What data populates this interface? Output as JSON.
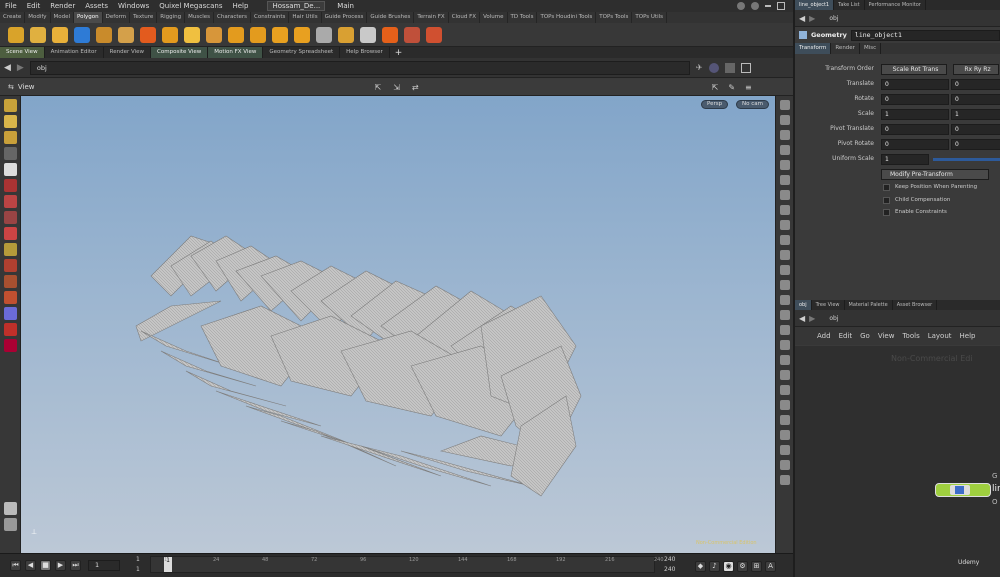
{
  "menubar": {
    "items": [
      "File",
      "Edit",
      "Render",
      "Assets",
      "Windows",
      "Quixel Megascans",
      "Help"
    ],
    "desktop": "Hossam_De...",
    "main": "Main"
  },
  "shelf_tabs": [
    "Create",
    "Modify",
    "Model",
    "Polygon",
    "Deform",
    "Texture",
    "Rigging",
    "Muscles",
    "Characters",
    "Constraints",
    "Hair Utils",
    "Guide Process",
    "Guide Brushes",
    "Terrain FX",
    "Cloud FX",
    "Volume",
    "TD Tools",
    "TOPs Houdini Tools",
    "TOPs Tools",
    "TOPs Utils"
  ],
  "shelf_tools": [
    {
      "icon": "poly-extrude-icon",
      "color": "#d9a32a"
    },
    {
      "icon": "poly-box-icon",
      "color": "#e0b040"
    },
    {
      "icon": "poly-cube-icon",
      "color": "#e8b03a"
    },
    {
      "icon": "poly-blue-icon",
      "color": "#2e7bd6"
    },
    {
      "icon": "poly-bevel-icon",
      "color": "#c98b2b"
    },
    {
      "icon": "poly-disc-icon",
      "color": "#d4a04a"
    },
    {
      "icon": "poly-sphere-icon",
      "color": "#e35b1e"
    },
    {
      "icon": "poly-diamond-icon",
      "color": "#e39b1e"
    },
    {
      "icon": "star-icon",
      "color": "#f0c040"
    },
    {
      "icon": "poly-planet-icon",
      "color": "#d7963a"
    },
    {
      "icon": "poly-diamond2-icon",
      "color": "#e39b1e"
    },
    {
      "icon": "poly-diamond3-icon",
      "color": "#e39b1e"
    },
    {
      "icon": "poly-diamond4-icon",
      "color": "#e8a020"
    },
    {
      "icon": "poly-diamond5-icon",
      "color": "#e8a020"
    },
    {
      "icon": "brush-icon",
      "color": "#aaaaaa"
    },
    {
      "icon": "planet-ring-icon",
      "color": "#d9a032"
    },
    {
      "icon": "cloud-tool-icon",
      "color": "#c9c9c9"
    },
    {
      "icon": "fire-icon",
      "color": "#e5601a"
    },
    {
      "icon": "stamp-icon",
      "color": "#c0503a"
    },
    {
      "icon": "book-icon",
      "color": "#d05030"
    }
  ],
  "pane_tabs": [
    "Scene View",
    "Animation Editor",
    "Render View",
    "Composite View",
    "Motion FX View",
    "Geometry Spreadsheet",
    "Help Browser"
  ],
  "path": "obj",
  "viewer": {
    "label": "View",
    "persp": "Persp",
    "cam": "No cam",
    "watermark": "Non-Commercial Edition"
  },
  "timeline": {
    "frame": "1",
    "start": "1",
    "start2": "1",
    "end": "240",
    "end2": "240",
    "ticks": [
      "1",
      "24",
      "48",
      "72",
      "96",
      "120",
      "144",
      "168",
      "192",
      "216",
      "240"
    ]
  },
  "right_panel": {
    "tabs": [
      "line_object1",
      "Take List",
      "Performance Monitor"
    ],
    "path": "obj",
    "node_type": "Geometry",
    "node_name": "line_object1",
    "param_tabs": [
      "Transform",
      "Render",
      "Misc"
    ],
    "transform_order_label": "Transform Order",
    "transform_order": "Scale Rot Trans",
    "rot_order": "Rx Ry Rz",
    "params": [
      {
        "label": "Translate",
        "v1": "0",
        "v2": "0"
      },
      {
        "label": "Rotate",
        "v1": "0",
        "v2": "0"
      },
      {
        "label": "Scale",
        "v1": "1",
        "v2": "1"
      },
      {
        "label": "Pivot Translate",
        "v1": "0",
        "v2": "0"
      },
      {
        "label": "Pivot Rotate",
        "v1": "0",
        "v2": "0"
      }
    ],
    "uniform_scale_label": "Uniform Scale",
    "uniform_scale": "1",
    "modify_pre": "Modify Pre-Transform",
    "checkboxes": [
      "Keep Position When Parenting",
      "Child Compensation",
      "Enable Constraints"
    ],
    "network_tabs": [
      "obj",
      "Tree View",
      "Material Palette",
      "Asset Browser"
    ],
    "network_path": "obj",
    "network_menu": [
      "Add",
      "Edit",
      "Go",
      "View",
      "Tools",
      "Layout",
      "Help"
    ],
    "network_watermark": "Non-Commercial Edi",
    "node_label": "lin",
    "node_label_top": "G",
    "node_label_bottom": "O",
    "udemy": "Udemy"
  }
}
